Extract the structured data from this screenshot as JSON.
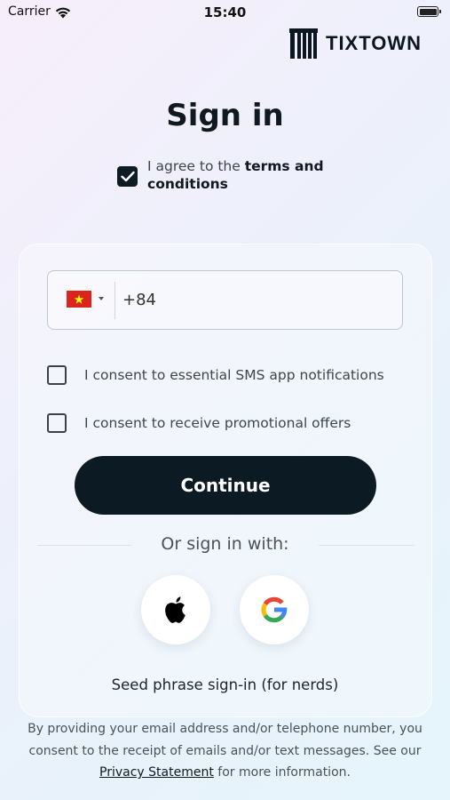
{
  "status_bar": {
    "carrier": "Carrier",
    "time": "15:40"
  },
  "brand": {
    "name": "TIXTOWN",
    "icon": "tixtown-logo-icon"
  },
  "title": "Sign in",
  "terms": {
    "checked": true,
    "prefix": "I agree to the ",
    "link": "terms and conditions"
  },
  "phone": {
    "country_icon": "vietnam-flag-icon",
    "value": "+84"
  },
  "consents": [
    {
      "label": "I consent to essential SMS app notifications",
      "checked": false
    },
    {
      "label": "I consent to receive promotional offers",
      "checked": false
    }
  ],
  "continue_label": "Continue",
  "social": {
    "divider_text": "Or sign in with:",
    "providers": [
      {
        "name": "Apple",
        "icon": "apple-icon"
      },
      {
        "name": "Google",
        "icon": "google-icon"
      }
    ]
  },
  "seed_phrase_label": "Seed phrase sign-in (for nerds)",
  "footer": {
    "text_before": "By providing your email address and/or telephone number, you consent to the receipt of emails and/or text messages. See our ",
    "link": "Privacy Statement",
    "text_after": " for more information."
  },
  "colors": {
    "primary_dark": "#0c1a24",
    "vn_flag_red": "#da251d",
    "vn_flag_star": "#ffff00"
  }
}
